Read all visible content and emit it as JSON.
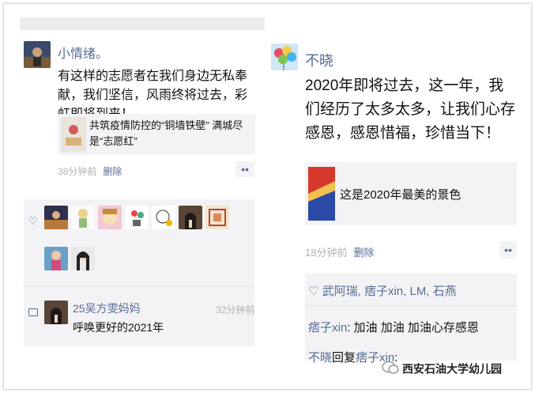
{
  "left_post": {
    "username": "小情绪。",
    "text": "有这样的志愿者在我们身边无私奉献，我们坚信，风雨终将过去，彩虹即将到来！",
    "link_title": "共筑疫情防控的“铜墙铁壁” 满城尽是“志愿红”",
    "time": "38分钟前",
    "delete": "删除",
    "more": "••",
    "comment_user": "25吴方雯妈妈",
    "comment_time": "32分钟前",
    "comment_text": "呼唤更好的2021年"
  },
  "right_post": {
    "username": "不晓",
    "text": "2020年即将过去，这一年，我们经历了太多太多，让我们心存感恩，感恩惜福，珍惜当下！",
    "link_title": "这是2020年最美的景色",
    "time": "18分钟前",
    "delete": "删除",
    "more": "••",
    "likes": "武阿瑞, 痞子xin, LM, 石燕",
    "comment1_user": "痞子xin",
    "comment1_text": "加油 加油  加油心存感恩",
    "comment2_user": "不晓",
    "comment2_mid": "回复",
    "comment2_target": "痞子xin",
    "comment2_sep": ":"
  },
  "watermark": "西安石油大学幼儿园",
  "colors": {
    "link_blue": "#576b95",
    "panel_bg": "#f3f3f5"
  },
  "icons": [
    "heart-icon",
    "comment-icon",
    "wechat-logo-icon"
  ]
}
